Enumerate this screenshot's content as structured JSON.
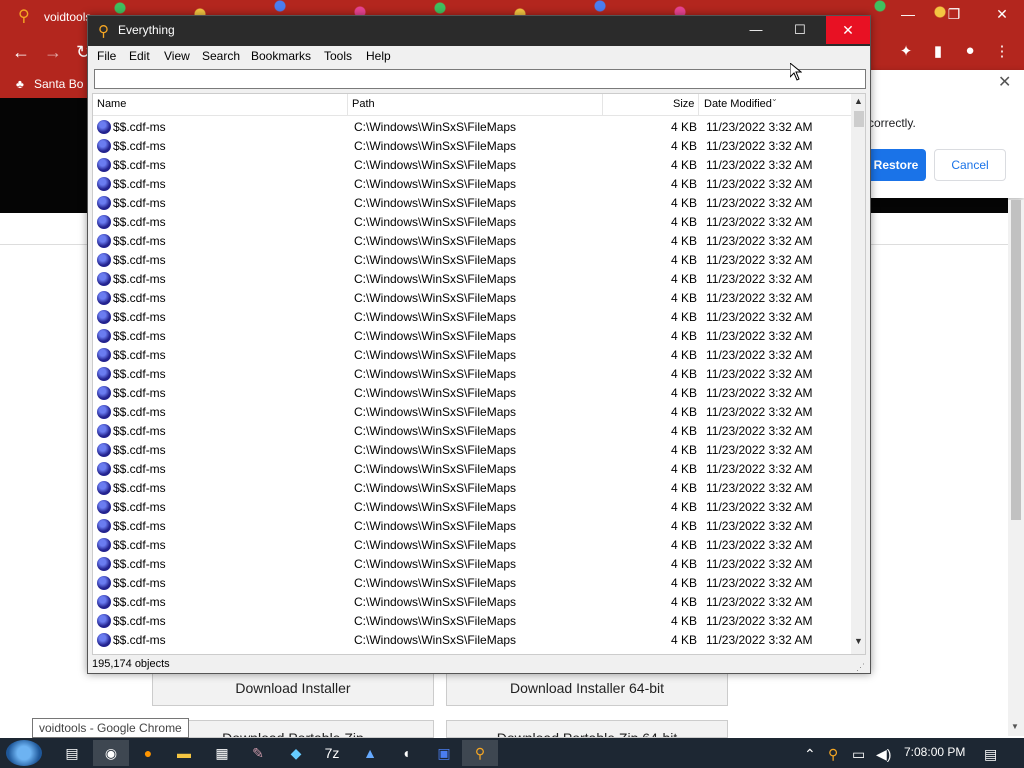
{
  "chrome": {
    "tab_title": "voidtools",
    "bookmark": "Santa Bo",
    "restore_text": "correctly.",
    "restore_label": "Restore",
    "cancel_label": "Cancel",
    "download_installer": "Download Installer",
    "download_installer64": "Download Installer 64-bit",
    "download_zip": "Download Portable Zip",
    "download_zip64": "Download Portable Zip 64-bit",
    "tooltip": "voidtools - Google Chrome"
  },
  "everything": {
    "title": "Everything",
    "menu": [
      "File",
      "Edit",
      "View",
      "Search",
      "Bookmarks",
      "Tools",
      "Help"
    ],
    "search_value": "",
    "columns": {
      "name": "Name",
      "path": "Path",
      "size": "Size",
      "date": "Date Modified"
    },
    "rows": [
      {
        "name": "$$.cdf-ms",
        "path": "C:\\Windows\\WinSxS\\FileMaps",
        "size": "4 KB",
        "date": "11/23/2022 3:32 AM"
      },
      {
        "name": "$$.cdf-ms",
        "path": "C:\\Windows\\WinSxS\\FileMaps",
        "size": "4 KB",
        "date": "11/23/2022 3:32 AM"
      },
      {
        "name": "$$.cdf-ms",
        "path": "C:\\Windows\\WinSxS\\FileMaps",
        "size": "4 KB",
        "date": "11/23/2022 3:32 AM"
      },
      {
        "name": "$$.cdf-ms",
        "path": "C:\\Windows\\WinSxS\\FileMaps",
        "size": "4 KB",
        "date": "11/23/2022 3:32 AM"
      },
      {
        "name": "$$.cdf-ms",
        "path": "C:\\Windows\\WinSxS\\FileMaps",
        "size": "4 KB",
        "date": "11/23/2022 3:32 AM"
      },
      {
        "name": "$$.cdf-ms",
        "path": "C:\\Windows\\WinSxS\\FileMaps",
        "size": "4 KB",
        "date": "11/23/2022 3:32 AM"
      },
      {
        "name": "$$.cdf-ms",
        "path": "C:\\Windows\\WinSxS\\FileMaps",
        "size": "4 KB",
        "date": "11/23/2022 3:32 AM"
      },
      {
        "name": "$$.cdf-ms",
        "path": "C:\\Windows\\WinSxS\\FileMaps",
        "size": "4 KB",
        "date": "11/23/2022 3:32 AM"
      },
      {
        "name": "$$.cdf-ms",
        "path": "C:\\Windows\\WinSxS\\FileMaps",
        "size": "4 KB",
        "date": "11/23/2022 3:32 AM"
      },
      {
        "name": "$$.cdf-ms",
        "path": "C:\\Windows\\WinSxS\\FileMaps",
        "size": "4 KB",
        "date": "11/23/2022 3:32 AM"
      },
      {
        "name": "$$.cdf-ms",
        "path": "C:\\Windows\\WinSxS\\FileMaps",
        "size": "4 KB",
        "date": "11/23/2022 3:32 AM"
      },
      {
        "name": "$$.cdf-ms",
        "path": "C:\\Windows\\WinSxS\\FileMaps",
        "size": "4 KB",
        "date": "11/23/2022 3:32 AM"
      },
      {
        "name": "$$.cdf-ms",
        "path": "C:\\Windows\\WinSxS\\FileMaps",
        "size": "4 KB",
        "date": "11/23/2022 3:32 AM"
      },
      {
        "name": "$$.cdf-ms",
        "path": "C:\\Windows\\WinSxS\\FileMaps",
        "size": "4 KB",
        "date": "11/23/2022 3:32 AM"
      },
      {
        "name": "$$.cdf-ms",
        "path": "C:\\Windows\\WinSxS\\FileMaps",
        "size": "4 KB",
        "date": "11/23/2022 3:32 AM"
      },
      {
        "name": "$$.cdf-ms",
        "path": "C:\\Windows\\WinSxS\\FileMaps",
        "size": "4 KB",
        "date": "11/23/2022 3:32 AM"
      },
      {
        "name": "$$.cdf-ms",
        "path": "C:\\Windows\\WinSxS\\FileMaps",
        "size": "4 KB",
        "date": "11/23/2022 3:32 AM"
      },
      {
        "name": "$$.cdf-ms",
        "path": "C:\\Windows\\WinSxS\\FileMaps",
        "size": "4 KB",
        "date": "11/23/2022 3:32 AM"
      },
      {
        "name": "$$.cdf-ms",
        "path": "C:\\Windows\\WinSxS\\FileMaps",
        "size": "4 KB",
        "date": "11/23/2022 3:32 AM"
      },
      {
        "name": "$$.cdf-ms",
        "path": "C:\\Windows\\WinSxS\\FileMaps",
        "size": "4 KB",
        "date": "11/23/2022 3:32 AM"
      },
      {
        "name": "$$.cdf-ms",
        "path": "C:\\Windows\\WinSxS\\FileMaps",
        "size": "4 KB",
        "date": "11/23/2022 3:32 AM"
      },
      {
        "name": "$$.cdf-ms",
        "path": "C:\\Windows\\WinSxS\\FileMaps",
        "size": "4 KB",
        "date": "11/23/2022 3:32 AM"
      },
      {
        "name": "$$.cdf-ms",
        "path": "C:\\Windows\\WinSxS\\FileMaps",
        "size": "4 KB",
        "date": "11/23/2022 3:32 AM"
      },
      {
        "name": "$$.cdf-ms",
        "path": "C:\\Windows\\WinSxS\\FileMaps",
        "size": "4 KB",
        "date": "11/23/2022 3:32 AM"
      },
      {
        "name": "$$.cdf-ms",
        "path": "C:\\Windows\\WinSxS\\FileMaps",
        "size": "4 KB",
        "date": "11/23/2022 3:32 AM"
      },
      {
        "name": "$$.cdf-ms",
        "path": "C:\\Windows\\WinSxS\\FileMaps",
        "size": "4 KB",
        "date": "11/23/2022 3:32 AM"
      },
      {
        "name": "$$.cdf-ms",
        "path": "C:\\Windows\\WinSxS\\FileMaps",
        "size": "4 KB",
        "date": "11/23/2022 3:32 AM"
      },
      {
        "name": "$$.cdf-ms",
        "path": "C:\\Windows\\WinSxS\\FileMaps",
        "size": "4 KB",
        "date": "11/23/2022 3:32 AM"
      }
    ],
    "status": "195,174 objects"
  },
  "taskbar": {
    "clock": "7:08:00 PM",
    "icons": [
      "chrome-icon",
      "firefox-icon",
      "folder-icon",
      "task-view-icon",
      "tools-icon",
      "network-icon",
      "7zip-icon",
      "app-icon",
      "media-icon",
      "terminal-icon",
      "everything-icon"
    ]
  },
  "colors": {
    "chrome_red": "#b3261e",
    "accent_blue": "#1a73e8",
    "close_red": "#e81123"
  }
}
